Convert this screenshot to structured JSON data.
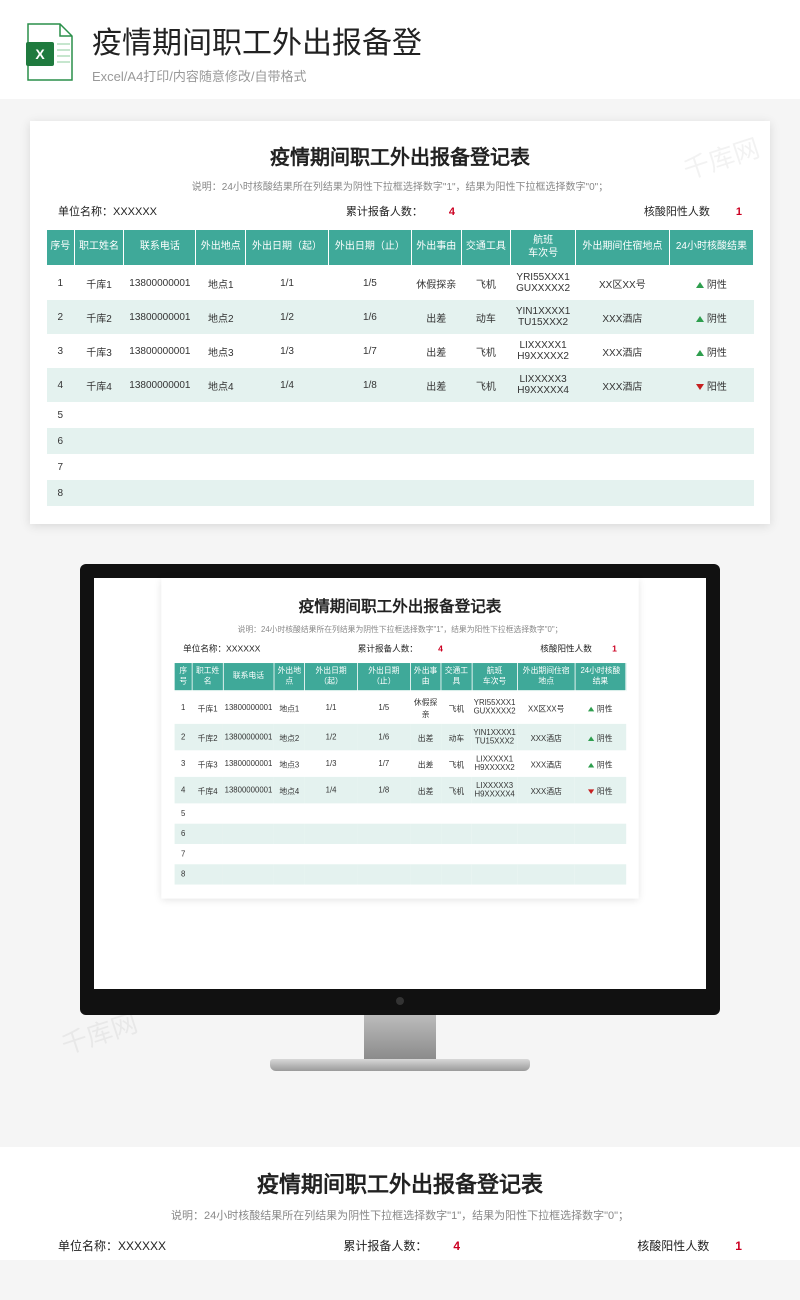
{
  "hero": {
    "title": "疫情期间职工外出报备登",
    "subtitle": "Excel/A4打印/内容随意修改/自带格式"
  },
  "sheet": {
    "title": "疫情期间职工外出报备登记表",
    "note_prefix": "说明：24小时核酸结果所在列结果为阴性下拉框选择数字\"1\"，结果为阳性下拉框选择数字\"0\"；",
    "summary": {
      "unit_label": "单位名称：",
      "unit_value": "XXXXXX",
      "count_label": "累计报备人数：",
      "count_value": "4",
      "pos_label": "核酸阳性人数",
      "pos_value": "1"
    },
    "columns": [
      "序号",
      "职工姓名",
      "联系电话",
      "外出地点",
      "外出日期（起）",
      "外出日期（止）",
      "外出事由",
      "交通工具",
      "航班\n车次号",
      "外出期间住宿地点",
      "24小时核酸结果"
    ],
    "rows": [
      {
        "no": "1",
        "name": "千库1",
        "tel": "13800000001",
        "place": "地点1",
        "from": "1/1",
        "to": "1/5",
        "reason": "休假探亲",
        "vehicle": "飞机",
        "flight": "YRI55XXX1\nGUXXXXX2",
        "stay": "XX区XX号",
        "result": "阴性",
        "dir": "up"
      },
      {
        "no": "2",
        "name": "千库2",
        "tel": "13800000001",
        "place": "地点2",
        "from": "1/2",
        "to": "1/6",
        "reason": "出差",
        "vehicle": "动车",
        "flight": "YIN1XXXX1\nTU15XXX2",
        "stay": "XXX酒店",
        "result": "阴性",
        "dir": "up"
      },
      {
        "no": "3",
        "name": "千库3",
        "tel": "13800000001",
        "place": "地点3",
        "from": "1/3",
        "to": "1/7",
        "reason": "出差",
        "vehicle": "飞机",
        "flight": "LIXXXXX1\nH9XXXXX2",
        "stay": "XXX酒店",
        "result": "阴性",
        "dir": "up"
      },
      {
        "no": "4",
        "name": "千库4",
        "tel": "13800000001",
        "place": "地点4",
        "from": "1/4",
        "to": "1/8",
        "reason": "出差",
        "vehicle": "飞机",
        "flight": "LIXXXXX3\nH9XXXXX4",
        "stay": "XXX酒店",
        "result": "阳性",
        "dir": "down"
      }
    ],
    "empty_rows": [
      "5",
      "6",
      "7",
      "8"
    ]
  },
  "watermark": "千库网"
}
